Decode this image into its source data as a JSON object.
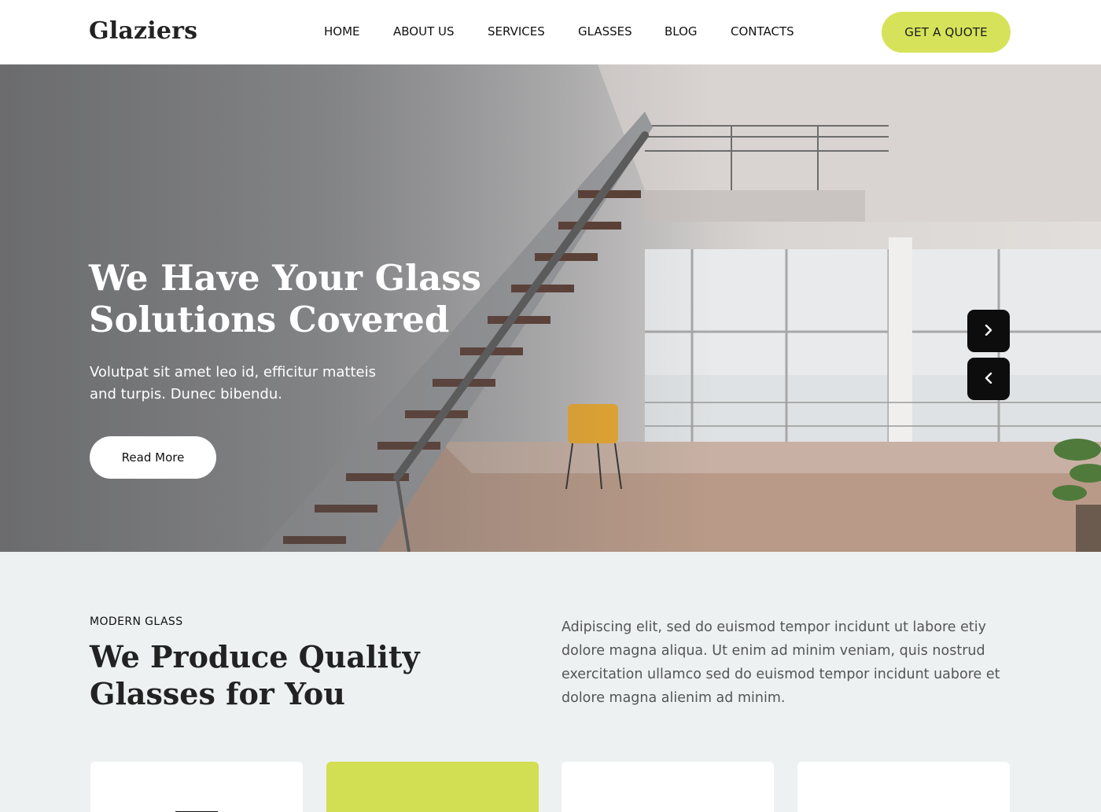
{
  "header": {
    "logo": "Glaziers",
    "nav": [
      "HOME",
      "ABOUT US",
      "SERVICES",
      "GLASSES",
      "BLOG",
      "CONTACTS"
    ],
    "cta": "GET A QUOTE"
  },
  "hero": {
    "title": "We Have Your Glass Solutions Covered",
    "subtitle": "Volutpat sit amet leo id, efficitur matteis and turpis. Dunec bibendu.",
    "button": "Read More"
  },
  "about": {
    "eyebrow": "MODERN GLASS",
    "title": "We Produce Quality Glasses for You",
    "text": "Adipiscing elit, sed do euismod tempor incidunt ut labore etiy dolore magna aliqua. Ut enim ad minim veniam, quis nostrud exercitation ullamco sed do euismod tempor incidunt uabore et dolore magna alienim ad minim."
  },
  "colors": {
    "accent": "#d6e35a",
    "section_bg": "#edf1f2",
    "dark": "#0d0d0d"
  }
}
